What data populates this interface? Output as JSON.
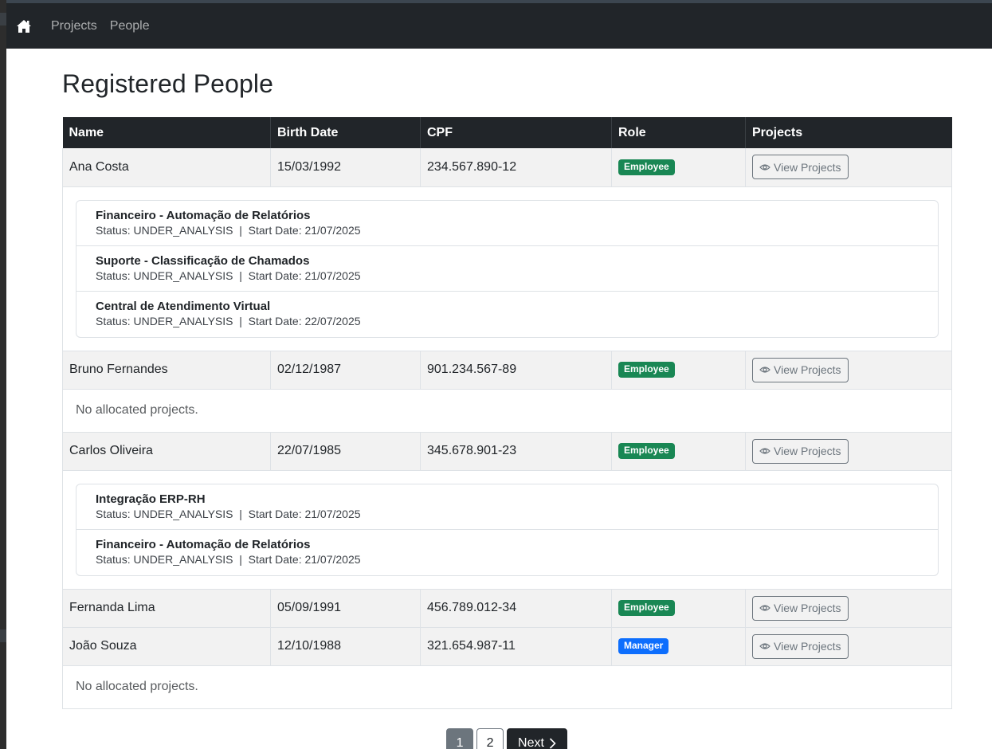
{
  "nav": {
    "home_icon": "home-icon",
    "links": [
      "Projects",
      "People"
    ]
  },
  "page": {
    "title": "Registered People"
  },
  "table": {
    "headers": [
      "Name",
      "Birth Date",
      "CPF",
      "Role",
      "Projects"
    ],
    "view_label": "View Projects",
    "empty_label": "No allocated projects.",
    "people": [
      {
        "name": "Ana Costa",
        "birth": "15/03/1992",
        "cpf": "234.567.890-12",
        "role": "Employee",
        "projects": [
          {
            "name": "Financeiro - Automação de Relatórios",
            "meta": "Status: UNDER_ANALYSIS  |  Start Date: 21/07/2025"
          },
          {
            "name": "Suporte - Classificação de Chamados",
            "meta": "Status: UNDER_ANALYSIS  |  Start Date: 21/07/2025"
          },
          {
            "name": "Central de Atendimento Virtual",
            "meta": "Status: UNDER_ANALYSIS  |  Start Date: 22/07/2025"
          }
        ]
      },
      {
        "name": "Bruno Fernandes",
        "birth": "02/12/1987",
        "cpf": "901.234.567-89",
        "role": "Employee"
      },
      {
        "name": "Carlos Oliveira",
        "birth": "22/07/1985",
        "cpf": "345.678.901-23",
        "role": "Employee",
        "projects": [
          {
            "name": "Integração ERP-RH",
            "meta": "Status: UNDER_ANALYSIS  |  Start Date: 21/07/2025"
          },
          {
            "name": "Financeiro - Automação de Relatórios",
            "meta": "Status: UNDER_ANALYSIS  |  Start Date: 21/07/2025"
          }
        ]
      },
      {
        "name": "Fernanda Lima",
        "birth": "05/09/1991",
        "cpf": "456.789.012-34",
        "role": "Employee"
      },
      {
        "name": "João Souza",
        "birth": "12/10/1988",
        "cpf": "321.654.987-11",
        "role": "Manager"
      }
    ]
  },
  "pagination": {
    "pages": [
      "1",
      "2"
    ],
    "next_label": "Next"
  },
  "colors": {
    "navbar": "#212529",
    "employee_badge": "#198754",
    "manager_badge": "#0d6efd",
    "secondary": "#6c757d"
  }
}
